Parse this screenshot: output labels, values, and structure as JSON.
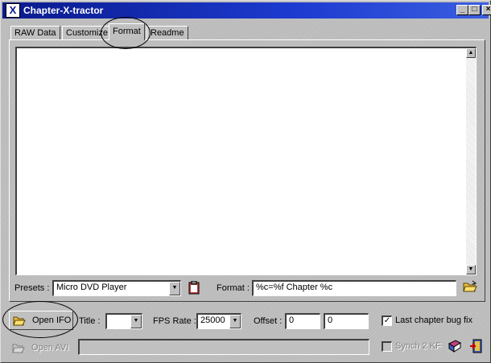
{
  "window": {
    "title": "Chapter-X-tractor",
    "app_icon_glyph": "X"
  },
  "titlebar_buttons": {
    "minimize": "_",
    "maximize": "□",
    "close": "×"
  },
  "tabs": [
    {
      "label": "RAW Data"
    },
    {
      "label": "Customize"
    },
    {
      "label": "Format",
      "active": true
    },
    {
      "label": "Readme"
    }
  ],
  "format_panel": {
    "text_content": "",
    "presets": {
      "label": "Presets :",
      "selected": "Micro DVD Player"
    },
    "format": {
      "label": "Format :",
      "value": "%c=%f Chapter %c"
    }
  },
  "bottom": {
    "open_ifo_label": "Open IFO",
    "title": {
      "label": "Title :",
      "selected": ""
    },
    "fps": {
      "label": "FPS Rate :",
      "selected": "25000"
    },
    "offset": {
      "label": "Offset :",
      "value1": "0",
      "value2": "0"
    },
    "last_chapter_fix": {
      "label": "Last chapter bug fix",
      "checked": true
    },
    "open_avi_label": "Open AVI",
    "avi_path": "",
    "synch_label": "Synch 2 KF",
    "synch_checked": false
  },
  "icons": {
    "folder_open": "folder-open-icon",
    "clipboard": "clipboard-icon",
    "book": "book-icon",
    "exit": "exit-door-icon"
  },
  "colors": {
    "titlebar": "#0a1a8c",
    "window_face": "#c0c0c0",
    "annotation": "#000000"
  }
}
